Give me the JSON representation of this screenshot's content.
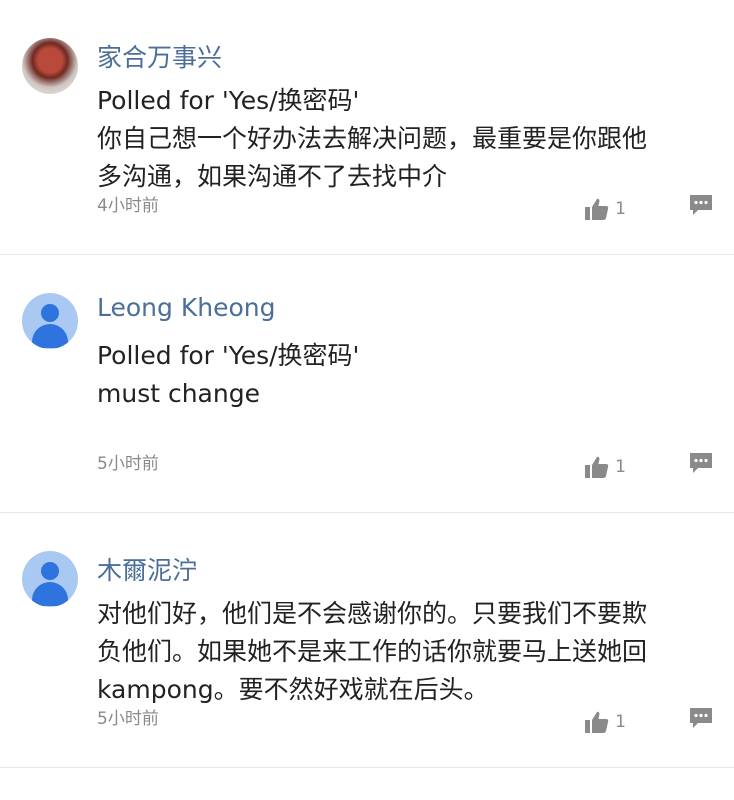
{
  "comments": [
    {
      "author": "家合万事兴",
      "avatar": "photo",
      "lines": [
        "Polled for 'Yes/换密码'",
        "你自己想一个好办法去解决问题，最重要是你跟他",
        "多沟通，如果沟通不了去找中介"
      ],
      "time": "4小时前",
      "likes": "1"
    },
    {
      "author": "Leong Kheong",
      "avatar": "default",
      "lines": [
        "Polled for 'Yes/换密码'",
        "must change"
      ],
      "time": "5小时前",
      "likes": "1"
    },
    {
      "author": "木爾泥泞",
      "avatar": "default",
      "lines": [
        "对他们好，他们是不会感谢你的。只要我们不要欺",
        "负他们。如果她不是来工作的话你就要马上送她回",
        "kampong。要不然好戏就在后头。"
      ],
      "time": "5小时前",
      "likes": "1"
    }
  ],
  "icons": {
    "like": "thumbs-up-icon",
    "reply": "comment-bubble-icon"
  },
  "colors": {
    "author": "#4b6f98",
    "avatar_default": "#2f74de",
    "avatar_bg": "#a9c9f3",
    "meta": "#8a8a8a"
  }
}
